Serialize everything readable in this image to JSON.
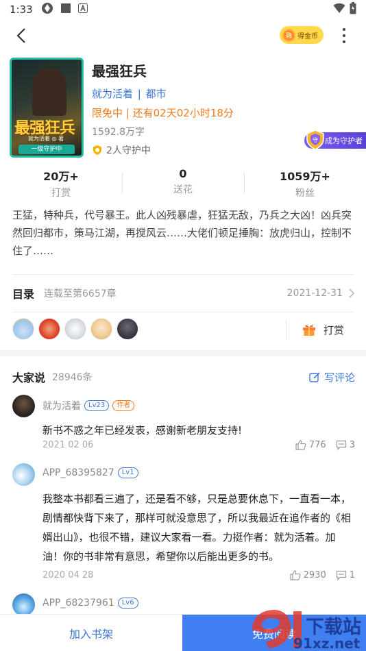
{
  "status_bar": {
    "time": "1:33"
  },
  "topbar": {
    "coin_label": "得金币",
    "coin_glyph": "融"
  },
  "book": {
    "title": "最强狂兵",
    "author": "就为活着",
    "category": "都市",
    "free_label": "限免中",
    "free_remaining": "还有02天02小时18分",
    "word_count": "1592.8万字",
    "guard_count": "2人守护中",
    "guard_button": "成为守护者",
    "cover_title": "最强狂兵",
    "cover_author": "就为活着 ◎ 著",
    "cover_badge": "一级守护中"
  },
  "stats": [
    {
      "value": "20万+",
      "label": "打赏"
    },
    {
      "value": "0",
      "label": "送花"
    },
    {
      "value": "1059万+",
      "label": "粉丝"
    }
  ],
  "description": "王猛，特种兵，代号暴王。此人凶残暴虐，狂猛无敌，乃兵之大凶！凶兵突然回归都市，策马江湖，再搅风云……大佬们顿足捶胸：放虎归山，控制不住了……",
  "catalog": {
    "title": "目录",
    "status": "连载至第6657章",
    "date": "2021-12-31"
  },
  "reward_label": "打赏",
  "comments_section": {
    "title": "大家说",
    "count": "28946条",
    "write_label": "写评论"
  },
  "comments": [
    {
      "user": "就为活着",
      "level": "Lv23",
      "role": "作者",
      "text": "新书不惑之年已经发表，感谢新老朋友支持!",
      "date": "2021 02 06",
      "likes": "776",
      "replies": "3"
    },
    {
      "user": "APP_68395827",
      "level": "Lv1",
      "role": "",
      "text": "我整本书都看三遍了，还是看不够，只是总要休息下，一直看一本，剧情都快背下来了，那样可就没意思了，所以我最近在追作者的《相婿出山》，也很不错，建议大家看一看。力挺作者：就为活着。加油！你的书非常有意思，希望你以后能出更多的书。",
      "date": "2020 04 28",
      "likes": "2930",
      "replies": "1"
    },
    {
      "user": "APP_68237961",
      "level": "Lv6",
      "role": "",
      "text": "",
      "date": "",
      "likes": "",
      "replies": ""
    }
  ],
  "bottom_bar": {
    "shelf_label": "加入书架",
    "read_label": "免费阅读"
  },
  "watermark": {
    "brand": "下载站",
    "domain": "91xz.net",
    "logo_number": "91"
  },
  "colors": {
    "accent_blue": "#3a76d6",
    "free_orange": "#f07a1a",
    "read_button": "#3f7ff0",
    "guard_purple": "#6a4de2"
  }
}
